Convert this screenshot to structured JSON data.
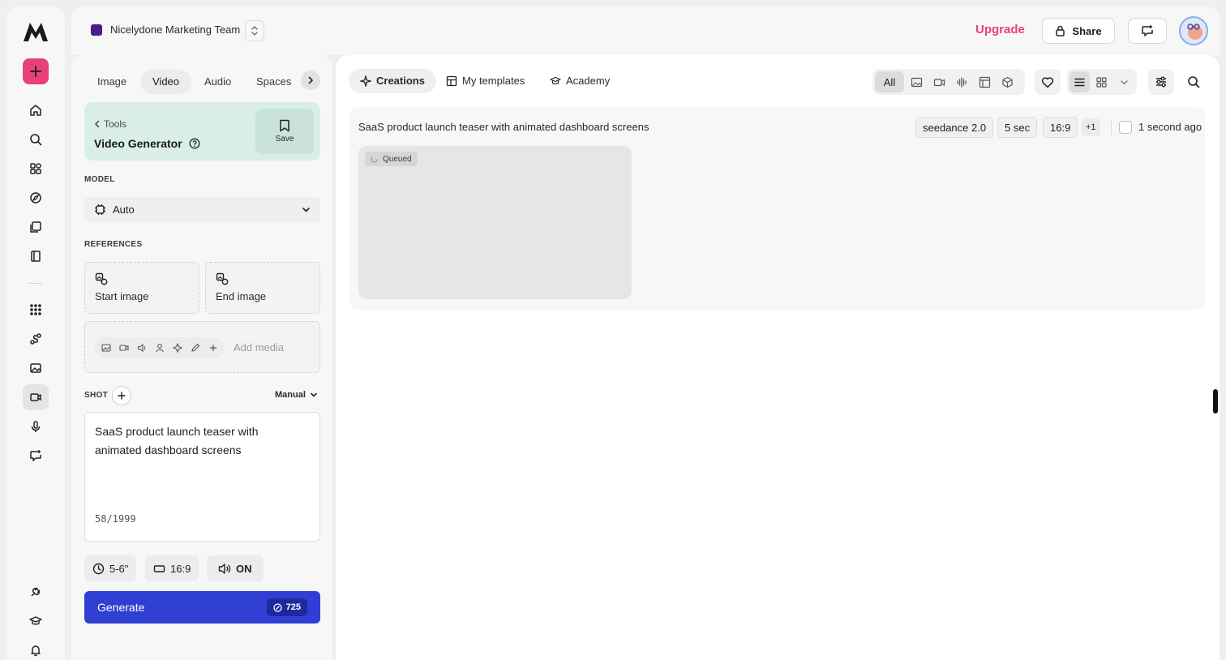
{
  "header": {
    "team_name": "Nicelydone Marketing Team",
    "upgrade": "Upgrade",
    "share": "Share"
  },
  "panel": {
    "tabs": [
      "Image",
      "Video",
      "Audio",
      "Spaces"
    ],
    "active_tab": "Video",
    "tools_link": "Tools",
    "tool_title": "Video Generator",
    "save": "Save",
    "model_label": "MODEL",
    "model_value": "Auto",
    "references_label": "REFERENCES",
    "start_image": "Start image",
    "end_image": "End image",
    "add_media": "Add media",
    "shot_label": "SHOT",
    "shot_mode": "Manual",
    "prompt": "SaaS product launch teaser with animated dashboard screens",
    "char_count": "58/1999",
    "duration": "5-6\"",
    "aspect": "16:9",
    "audio": "ON",
    "generate": "Generate",
    "credits": "725"
  },
  "main": {
    "tabs": [
      "Creations",
      "My templates",
      "Academy"
    ],
    "active_tab": "Creations",
    "filter_all": "All",
    "creation": {
      "title": "SaaS product launch teaser with animated dashboard screens",
      "model": "seedance 2.0",
      "duration": "5 sec",
      "aspect": "16:9",
      "more": "+1",
      "time": "1 second ago",
      "status": "Queued"
    }
  },
  "colors": {
    "accent_pink": "#e8407a",
    "generate_blue": "#2f3fd4",
    "tool_card_green": "#d8eee7",
    "team_swatch": "#4b1d8a"
  }
}
